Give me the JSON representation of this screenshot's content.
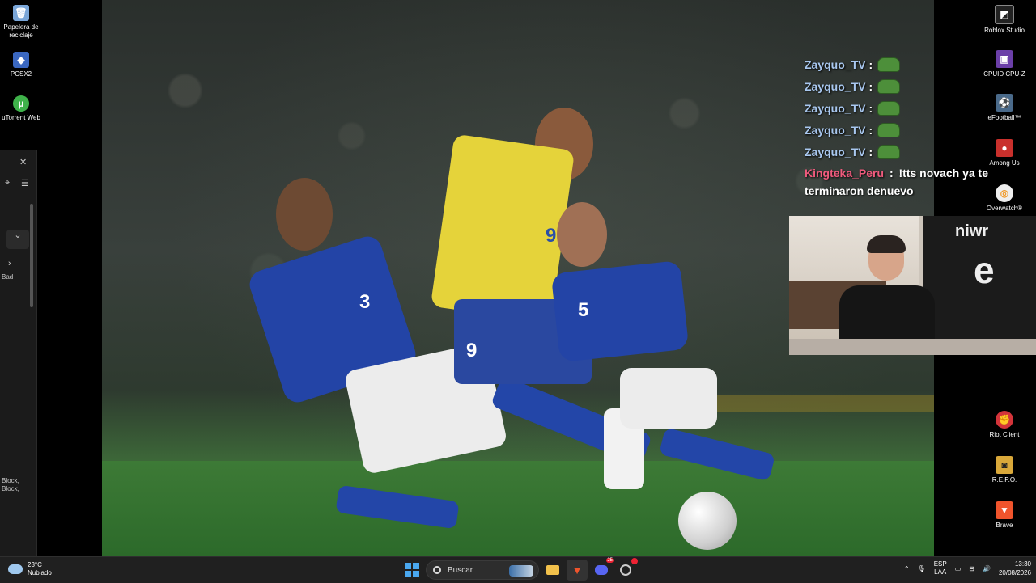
{
  "desktop_left": {
    "icons": [
      {
        "label": "Papelera de reciclaje",
        "icon": "recycle-bin-icon"
      },
      {
        "label": "PCSX2",
        "icon": "pcsx2-icon"
      },
      {
        "label": "uTorrent Web",
        "icon": "utorrent-icon"
      }
    ]
  },
  "left_panel": {
    "label_bad": "Bad",
    "label_block": "Block,",
    "label_block2": "Block,"
  },
  "chat": {
    "messages": [
      {
        "user": "Zayquo_TV",
        "sep": ":"
      },
      {
        "user": "Zayquo_TV",
        "sep": ":"
      },
      {
        "user": "Zayquo_TV",
        "sep": ":"
      },
      {
        "user": "Zayquo_TV",
        "sep": ":"
      },
      {
        "user": "Zayquo_TV",
        "sep": ":"
      },
      {
        "user": "Kingteka_Peru",
        "sep": ":",
        "text_line1": "!tts novach ya te",
        "text_line2": "terminaron denuevo"
      }
    ],
    "user_color": "#a9c8f0",
    "user_alt_color": "#f05b7d"
  },
  "webcam": {
    "shirt_text": "niwr",
    "shirt_letter": "e"
  },
  "wallpaper": {
    "numbers": [
      "3",
      "9",
      "5",
      "9"
    ]
  },
  "desktop_right": {
    "icons": [
      {
        "label": "Roblox Studio",
        "icon": "roblox-studio-icon"
      },
      {
        "label": "CPUID CPU-Z",
        "icon": "cpuz-icon"
      },
      {
        "label": "eFootball™",
        "icon": "efootball-icon"
      },
      {
        "label": "Among Us",
        "icon": "among-us-icon"
      },
      {
        "label": "Overwatch®",
        "icon": "overwatch-icon"
      },
      {
        "label": "Riot Client",
        "icon": "riot-client-icon"
      },
      {
        "label": "R.E.P.O.",
        "icon": "repo-icon"
      },
      {
        "label": "Brave",
        "icon": "brave-icon"
      }
    ]
  },
  "taskbar": {
    "weather_temp": "23°C",
    "weather_desc": "Nublado",
    "search_placeholder": "Buscar",
    "lang1": "ESP",
    "lang2": "LAA",
    "time": "13:30",
    "date": "20/08/2026",
    "discord_badge": "25"
  }
}
